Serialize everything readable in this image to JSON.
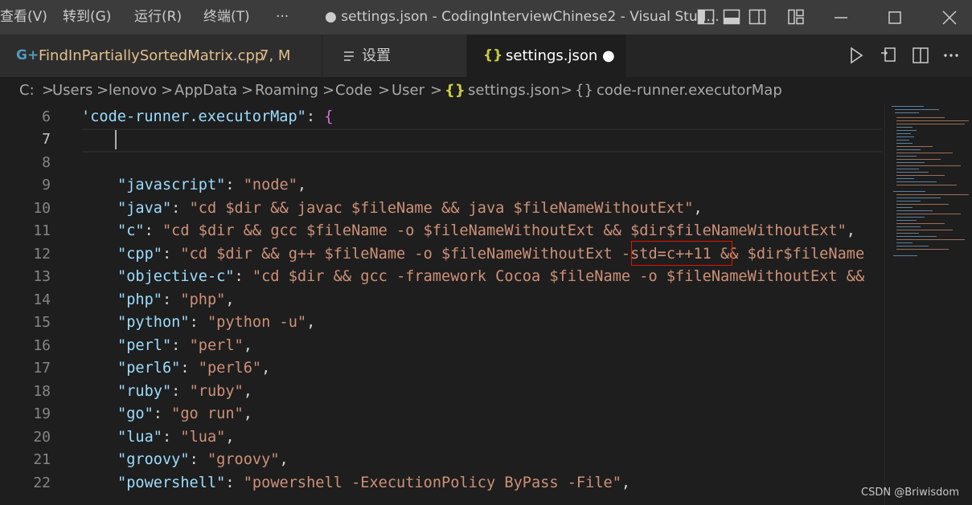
{
  "titlebar": {
    "menu": [
      "查看(V)",
      "转到(G)",
      "运行(R)",
      "终端(T)",
      "···"
    ],
    "title": "● settings.json - CodingInterviewChinese2 - Visual Stud..."
  },
  "tabs": [
    {
      "icon": "cpp-file-icon",
      "label": "FindInPartiallySortedMatrix.cpp",
      "badge": "7, M"
    },
    {
      "icon": "settings-list-icon",
      "label": "设置"
    },
    {
      "icon": "json-braces-icon",
      "label": "settings.json",
      "dirty": "●"
    }
  ],
  "breadcrumb": {
    "items": [
      "C:",
      "Users",
      "lenovo",
      "AppData",
      "Roaming",
      "Code",
      "User",
      "settings.json",
      "code-runner.executorMap"
    ],
    "sep": ">",
    "json_icon": "{}",
    "obj_icon": "{}"
  },
  "editor": {
    "line_numbers": [
      "6",
      "7",
      "8",
      "9",
      "10",
      "11",
      "12",
      "13",
      "14",
      "15",
      "16",
      "17",
      "18",
      "19",
      "20",
      "21",
      "22"
    ],
    "lines": {
      "l6_key": "'code-runner.executorMap\"",
      "l6_colon": ": ",
      "l6_brace": "{",
      "l9": [
        "\"javascript\"",
        "\"node\""
      ],
      "l10": [
        "\"java\"",
        "\"cd $dir && javac $fileName && java $fileNameWithoutExt\""
      ],
      "l11": [
        "\"c\"",
        "\"cd $dir && gcc $fileName -o $fileNameWithoutExt && $dir$fileNameWithoutExt\""
      ],
      "l12": [
        "\"cpp\"",
        "\"cd $dir && g++ $fileName -o $fileNameWithoutExt -std=c++11 && $dir$fileName"
      ],
      "l13": [
        "\"objective-c\"",
        "\"cd $dir && gcc -framework Cocoa $fileName -o $fileNameWithoutExt &&"
      ],
      "l14": [
        "\"php\"",
        "\"php\""
      ],
      "l15": [
        "\"python\"",
        "\"python -u\""
      ],
      "l16": [
        "\"perl\"",
        "\"perl\""
      ],
      "l17": [
        "\"perl6\"",
        "\"perl6\""
      ],
      "l18": [
        "\"ruby\"",
        "\"ruby\""
      ],
      "l19": [
        "\"go\"",
        "\"go run\""
      ],
      "l20": [
        "\"lua\"",
        "\"lua\""
      ],
      "l21": [
        "\"groovy\"",
        "\"groovy\""
      ],
      "l22": [
        "\"powershell\"",
        "\"powershell -ExecutionPolicy ByPass -File\""
      ]
    },
    "highlighted_text": "-std=c++11"
  },
  "watermark": "CSDN @Briwisdom",
  "colors": {
    "json_key": "#9cdcfe",
    "json_string": "#ce9178",
    "brace": "#da70d6",
    "tab_label_modified": "#e2c08d",
    "highlight_box": "#e51400"
  }
}
